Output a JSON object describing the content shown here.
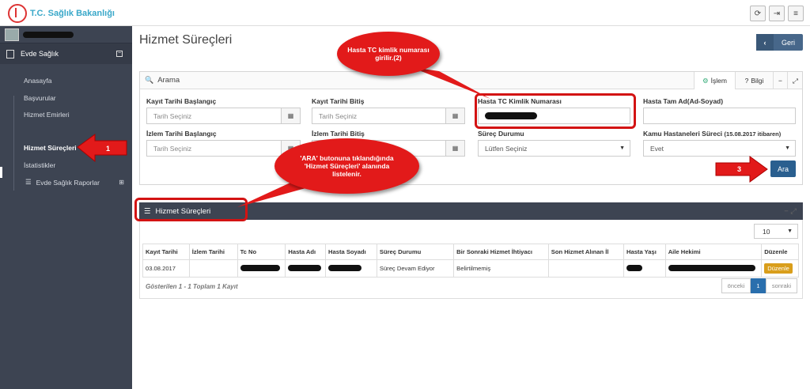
{
  "app": {
    "brand": "T.C. Sağlık Bakanlığı"
  },
  "topbar_icons": [
    "refresh-icon",
    "logout-icon",
    "menu-icon"
  ],
  "sidebar": {
    "module": "Evde Sağlık",
    "items": [
      {
        "label": "Anasayfa"
      },
      {
        "label": "Başvurular"
      },
      {
        "label": "Hizmet Emirleri"
      },
      {
        "label": "Hizmet Süreçleri"
      },
      {
        "label": "İstatistikler"
      },
      {
        "label": "Evde Sağlık Raporlar"
      }
    ]
  },
  "page": {
    "title": "Hizmet Süreçleri",
    "back": "Geri"
  },
  "search": {
    "title": "Arama",
    "tabs": {
      "islem": "İşlem",
      "bilgi": "Bilgi"
    },
    "fields": {
      "kayit_bas": {
        "label": "Kayıt Tarihi Başlangıç",
        "placeholder": "Tarih Seçiniz"
      },
      "kayit_bit": {
        "label": "Kayıt Tarihi Bitiş",
        "placeholder": "Tarih Seçiniz"
      },
      "tc": {
        "label": "Hasta TC Kimlik Numarası"
      },
      "ad": {
        "label": "Hasta Tam Ad(Ad-Soyad)"
      },
      "izlem_bas": {
        "label": "İzlem Tarihi Başlangıç",
        "placeholder": "Tarih Seçiniz"
      },
      "izlem_bit": {
        "label": "İzlem Tarihi Bitiş"
      },
      "surec": {
        "label": "Süreç Durumu",
        "value": "Lütfen Seçiniz"
      },
      "kamu": {
        "label": "Kamu Hastaneleri Süreci",
        "label_note": "(15.08.2017 itibaren)",
        "value": "Evet"
      }
    },
    "button": "Ara"
  },
  "list": {
    "title": "Hizmet Süreçleri",
    "page_size": "10",
    "columns": [
      "Kayıt Tarihi",
      "İzlem Tarihi",
      "Tc No",
      "Hasta Adı",
      "Hasta Soyadı",
      "Süreç Durumu",
      "Bir Sonraki Hizmet İhtiyacı",
      "Son Hizmet Alınan İl",
      "Hasta Yaşı",
      "Aile Hekimi",
      "Düzenle"
    ],
    "rows": [
      {
        "kayit": "03.08.2017",
        "izlem": "",
        "surec": "Süreç Devam Ediyor",
        "sonraki": "Belirtilmemiş",
        "edit": "Düzenle"
      }
    ],
    "info": "Gösterilen 1 - 1 Toplam 1 Kayıt",
    "pager": {
      "prev": "önceki",
      "page": "1",
      "next": "sonraki"
    }
  },
  "annotations": {
    "c1": "Hasta TC kimlik numarası girilir.(2)",
    "c2": "'ARA' butonuna tıklandığında 'Hizmet Süreçleri' alanında listelenir.",
    "n1": "1",
    "n3": "3"
  },
  "colors": {
    "sidebar": "#3d4452",
    "primary": "#2a5f8f",
    "callout": "#e21a1a",
    "edit": "#d99e1b"
  }
}
